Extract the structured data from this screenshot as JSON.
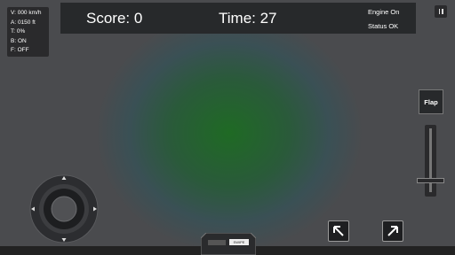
{
  "flight_info": {
    "velocity": "V: 000 km/h",
    "altitude": "A: 0150 ft",
    "throttle": "T: 0%",
    "brake": "B: ON",
    "flaps": "F: OFF"
  },
  "hud": {
    "score": "Score: 0",
    "time": "Time: 27",
    "engine": "Engine On",
    "status": "Status OK"
  },
  "controls": {
    "flap_label": "Flap",
    "throttle_level": 0,
    "pause_icon": "pause-icon",
    "left_icon": "arrow-up-left-icon",
    "right_icon": "arrow-up-right-icon",
    "joystick_icon": "joystick-icon"
  },
  "bottom_widget": {
    "label": "SWIPE"
  },
  "colors": {
    "background": "#4b4b4d",
    "ground": "#1f6a24",
    "panel": "#27292b"
  }
}
